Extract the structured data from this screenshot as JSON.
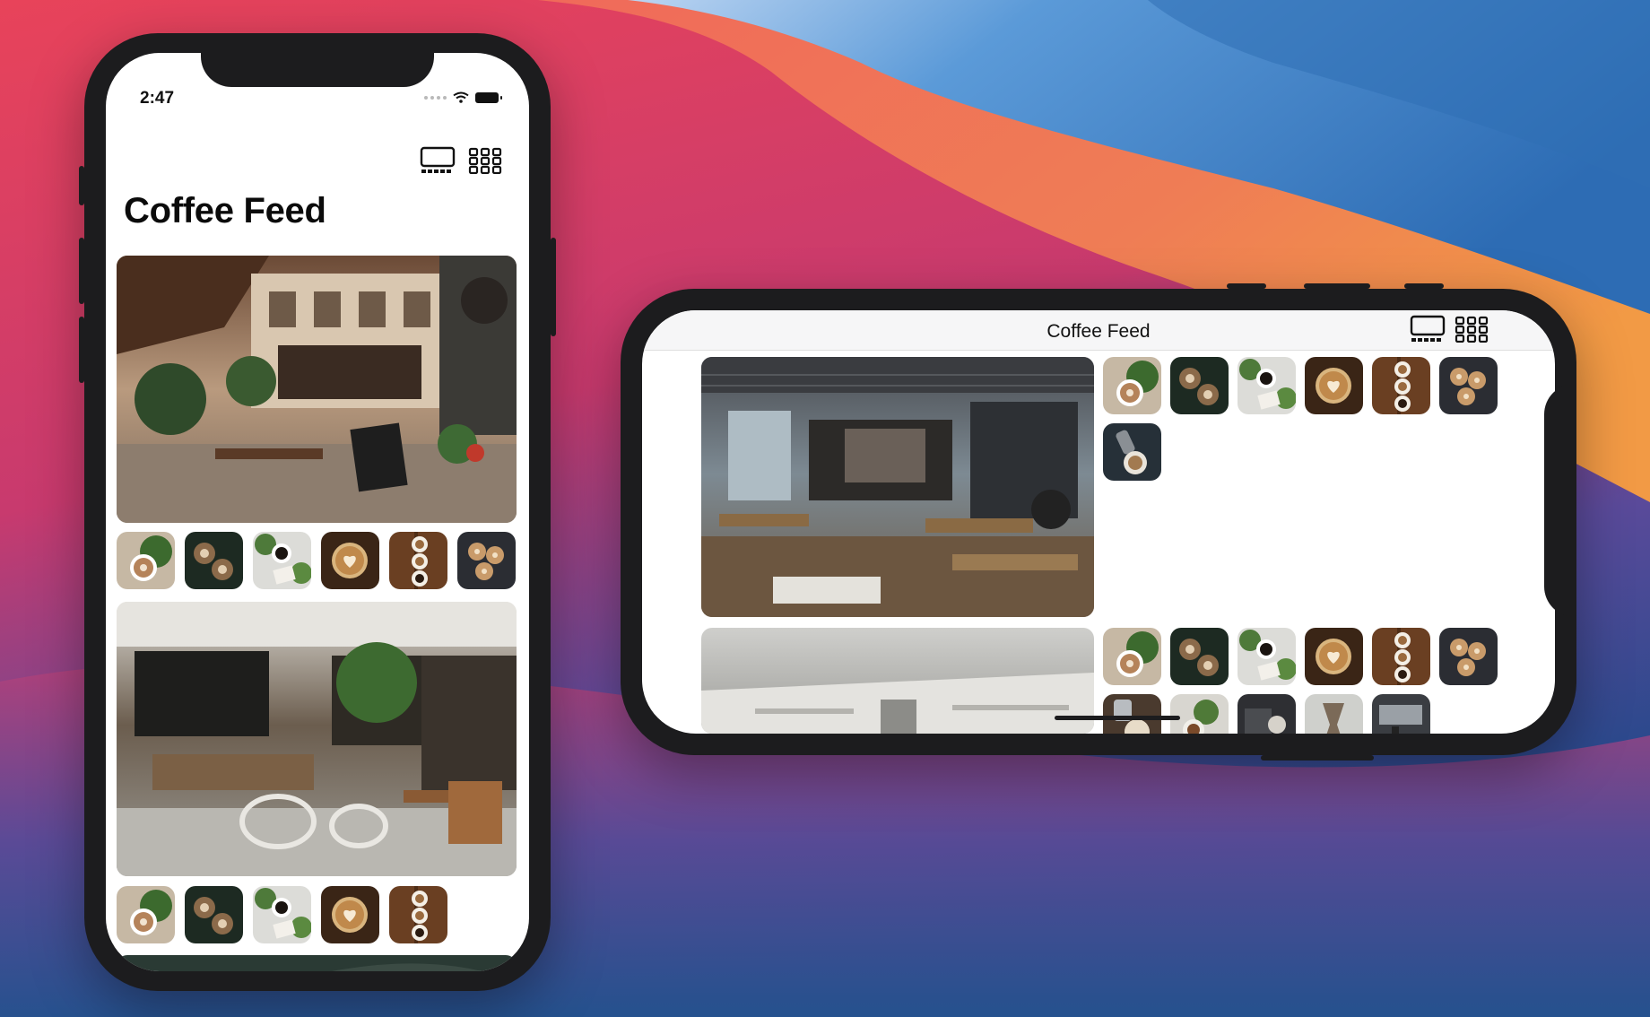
{
  "colors": {
    "wallpaper_red": "#e8435a",
    "wallpaper_orange": "#f0a040",
    "wallpaper_blue": "#2f6fb5",
    "wallpaper_navy": "#1f3f7a",
    "phone_frame": "#1c1c1e",
    "screen_bg": "#ffffff",
    "title_text": "#0b0b0b"
  },
  "portrait": {
    "status_bar": {
      "time": "2:47",
      "icons": [
        "cellular-dots-icon",
        "wifi-icon",
        "battery-icon"
      ]
    },
    "toolbar": {
      "icons": [
        "single-column-layout-icon",
        "grid-layout-icon"
      ]
    },
    "title": "Coffee Feed",
    "feed": [
      {
        "hero": "cafe-street-terrace-photo",
        "thumbnails": [
          "latte-art-thumb",
          "two-cups-dark-thumb",
          "espresso-plants-thumb",
          "heart-latte-thumb",
          "three-cups-wood-thumb",
          "three-cups-dark-thumb"
        ]
      },
      {
        "hero": "coffee-shop-interior-photo",
        "thumbnails": [
          "latte-art-thumb",
          "two-cups-dark-thumb",
          "espresso-plants-thumb",
          "heart-latte-thumb",
          "three-cups-wood-thumb"
        ]
      },
      {
        "hero": "cafe-ceiling-photo",
        "thumbnails": []
      }
    ]
  },
  "landscape": {
    "nav_title": "Coffee Feed",
    "toolbar": {
      "icons": [
        "single-column-layout-icon",
        "grid-layout-icon"
      ]
    },
    "feed": [
      {
        "hero": "industrial-cafe-interior-photo",
        "thumbnails": [
          "latte-art-thumb",
          "two-cups-dark-thumb",
          "espresso-plants-thumb",
          "heart-latte-thumb",
          "three-cups-wood-thumb",
          "three-cups-dark-thumb",
          "pour-over-thumb"
        ]
      },
      {
        "hero": "cafe-ceiling-photo",
        "thumbnails": [
          "latte-art-thumb",
          "two-cups-dark-thumb",
          "espresso-plants-thumb",
          "heart-latte-thumb",
          "three-cups-wood-thumb",
          "three-cups-dark-thumb",
          "pouring-milk-thumb",
          "plant-cup-thumb",
          "barista-thumb",
          "chemex-thumb",
          "espresso-machine-thumb"
        ]
      }
    ]
  }
}
